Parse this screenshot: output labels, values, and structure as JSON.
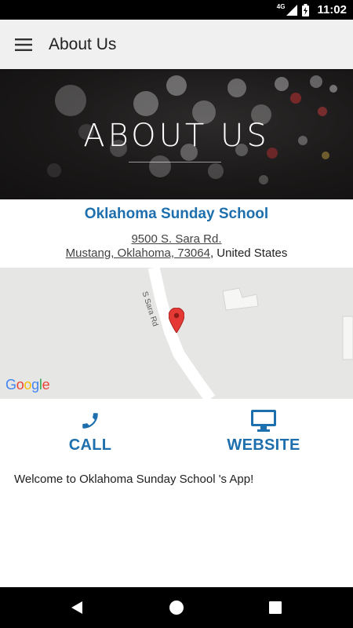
{
  "status_bar": {
    "network": "4G",
    "time": "11:02"
  },
  "app_bar": {
    "title": "About Us",
    "menu_icon": "hamburger-menu-icon"
  },
  "hero": {
    "title": "ABOUT US"
  },
  "organization": {
    "name": "Oklahoma Sunday School",
    "address_line1": "9500 S. Sara Rd.",
    "address_line2_link": "Mustang, Oklahoma, 73064",
    "address_line2_suffix": ", United States"
  },
  "map": {
    "road_label": "S Sara Rd",
    "logo_text": [
      "G",
      "o",
      "o",
      "g",
      "l",
      "e"
    ],
    "logo_colors": [
      "#4285F4",
      "#EA4335",
      "#FBBC05",
      "#4285F4",
      "#34A853",
      "#EA4335"
    ],
    "pin_color": "#e53935",
    "pin_icon": "map-pin-icon"
  },
  "actions": {
    "call_label": "CALL",
    "call_icon": "phone-icon",
    "website_label": "WEBSITE",
    "website_icon": "monitor-icon",
    "accent_color": "#1d6fad"
  },
  "welcome_text": "Welcome to Oklahoma Sunday School 's App!",
  "nav_bar": {
    "back_icon": "back-triangle-icon",
    "home_icon": "home-circle-icon",
    "recents_icon": "recents-square-icon"
  }
}
